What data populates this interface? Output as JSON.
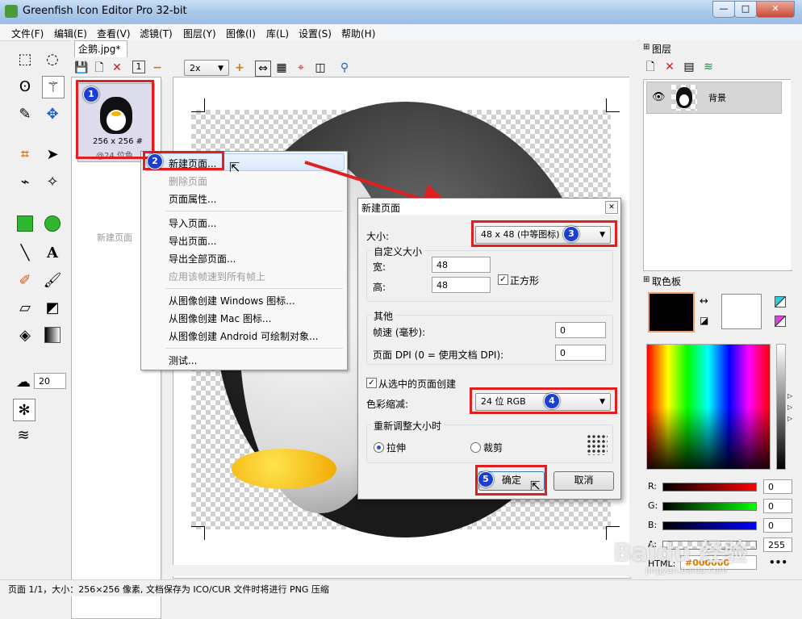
{
  "window": {
    "title": "Greenfish Icon Editor Pro 32-bit",
    "min": "—",
    "max": "□",
    "close": "✕"
  },
  "menu": [
    "文件(F)",
    "编辑(E)",
    "查看(V)",
    "滤镜(T)",
    "图层(Y)",
    "图像(I)",
    "库(L)",
    "设置(S)",
    "帮助(H)"
  ],
  "doc": {
    "tab": "企鹅.jpg*",
    "zoom": "2x",
    "one_label": "1"
  },
  "pagelist": {
    "thumb_size": "256 x 256 #",
    "thumb_depth": "@24 位色",
    "new_page": "新建页面"
  },
  "toolbox": {
    "brush_size": "20"
  },
  "context_menu": {
    "items": [
      {
        "label": "新建页面...",
        "disabled": false
      },
      {
        "label": "删除页面",
        "disabled": true
      },
      {
        "label": "页面属性...",
        "disabled": false
      },
      {
        "label": "导入页面...",
        "disabled": false
      },
      {
        "label": "导出页面...",
        "disabled": false
      },
      {
        "label": "导出全部页面...",
        "disabled": false
      },
      {
        "label": "应用该帧速到所有帧上",
        "disabled": true
      },
      {
        "label": "从图像创建 Windows 图标...",
        "disabled": false
      },
      {
        "label": "从图像创建 Mac 图标...",
        "disabled": false
      },
      {
        "label": "从图像创建 Android 可绘制对象...",
        "disabled": false
      },
      {
        "label": "测试...",
        "disabled": false
      }
    ]
  },
  "dialog": {
    "title": "新建页面",
    "close": "✕",
    "size_label": "大小:",
    "size_value": "48 x 48 (中等图标)",
    "custom_group": "自定义大小",
    "width_label": "宽:",
    "width_value": "48",
    "height_label": "高:",
    "height_value": "48",
    "square_label": "正方形",
    "other_group": "其他",
    "framerate_label": "帧速 (毫秒):",
    "framerate_value": "0",
    "dpi_label": "页面 DPI (0 = 使用文档 DPI):",
    "dpi_value": "0",
    "from_selected_label": "从选中的页面创建",
    "color_label": "色彩缩减:",
    "color_value": "24 位 RGB",
    "resize_group": "重新调整大小时",
    "stretch_label": "拉伸",
    "crop_label": "裁剪",
    "ok": "确定",
    "cancel": "取消"
  },
  "layers": {
    "title": "图层",
    "layer_name": "背景"
  },
  "palette": {
    "title": "取色板",
    "r_label": "R:",
    "r_value": "0",
    "g_label": "G:",
    "g_value": "0",
    "b_label": "B:",
    "b_value": "0",
    "a_label": "A:",
    "a_value": "255",
    "html_label": "HTML:",
    "html_value": "#000000",
    "more": "•••"
  },
  "badges": [
    "1",
    "2",
    "3",
    "4",
    "5"
  ],
  "status": "页面 1/1，大小：256×256 像素, 文档保存为 ICO/CUR 文件时将进行 PNG 压缩",
  "watermark": {
    "text": "Baidu 经验",
    "url": "jingyan.baidu.com"
  }
}
